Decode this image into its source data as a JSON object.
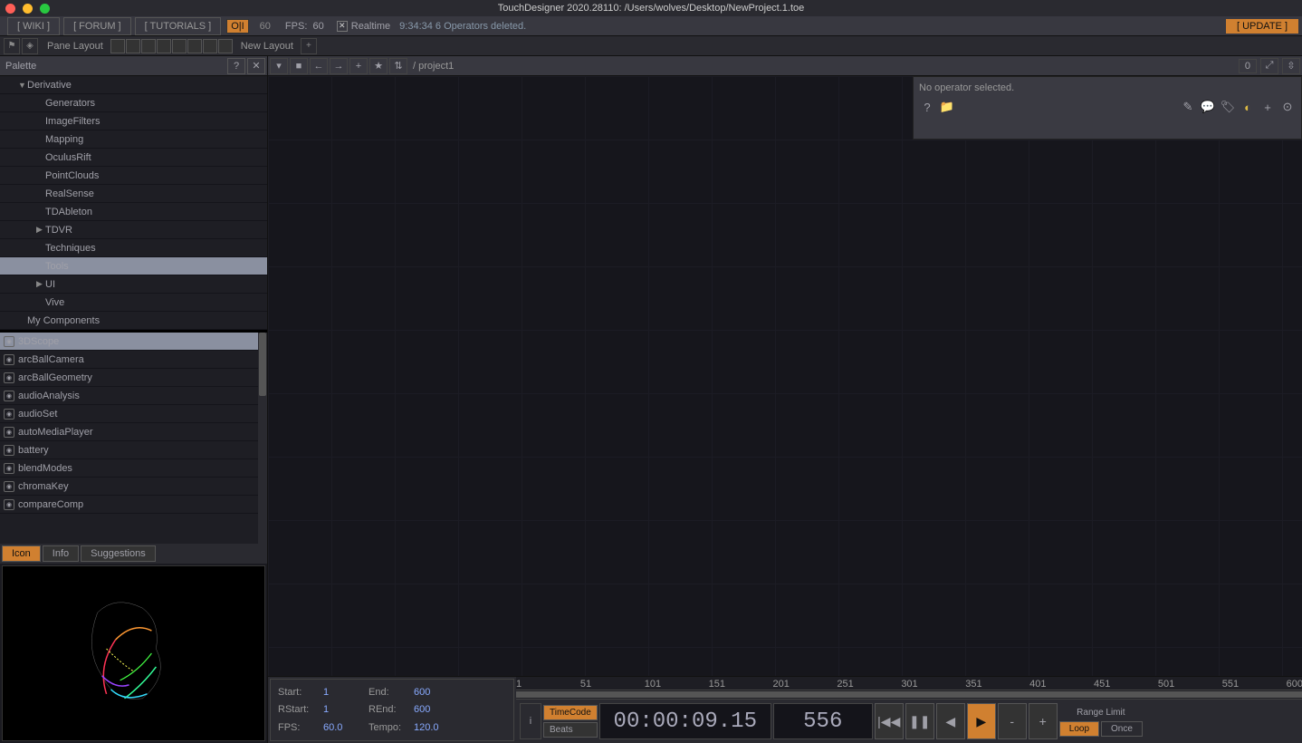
{
  "window_title": "TouchDesigner 2020.28110: /Users/wolves/Desktop/NewProject.1.toe",
  "topbar": {
    "wiki": "[  WIKI  ]",
    "forum": "[  FORUM  ]",
    "tutorials": "[  TUTORIALS  ]",
    "oii": "O|I",
    "sixty": "60",
    "fps_label": "FPS:",
    "fps_value": "60",
    "realtime": "Realtime",
    "status": "9:34:34 6 Operators deleted.",
    "update": "[  UPDATE  ]"
  },
  "panerow": {
    "pane_layout": "Pane Layout",
    "new_layout": "New Layout"
  },
  "palette": {
    "title": "Palette",
    "tree": [
      {
        "label": "Derivative",
        "level": 0,
        "arrow": "▼"
      },
      {
        "label": "Generators",
        "level": 1
      },
      {
        "label": "ImageFilters",
        "level": 1
      },
      {
        "label": "Mapping",
        "level": 1
      },
      {
        "label": "OculusRift",
        "level": 1
      },
      {
        "label": "PointClouds",
        "level": 1
      },
      {
        "label": "RealSense",
        "level": 1
      },
      {
        "label": "TDAbleton",
        "level": 1
      },
      {
        "label": "TDVR",
        "level": 1,
        "arrow": "▶"
      },
      {
        "label": "Techniques",
        "level": 1
      },
      {
        "label": "Tools",
        "level": 1,
        "selected": true
      },
      {
        "label": "UI",
        "level": 1,
        "arrow": "▶"
      },
      {
        "label": "Vive",
        "level": 1
      },
      {
        "label": "My Components",
        "level": 0
      }
    ],
    "components": [
      {
        "label": "3DScope",
        "selected": true
      },
      {
        "label": "arcBallCamera"
      },
      {
        "label": "arcBallGeometry"
      },
      {
        "label": "audioAnalysis"
      },
      {
        "label": "audioSet"
      },
      {
        "label": "autoMediaPlayer"
      },
      {
        "label": "battery"
      },
      {
        "label": "blendModes"
      },
      {
        "label": "chromaKey"
      },
      {
        "label": "compareComp"
      }
    ],
    "tabs": {
      "icon": "Icon",
      "info": "Info",
      "suggestions": "Suggestions"
    }
  },
  "network": {
    "path": "/ project1",
    "count": "0",
    "param_msg": "No operator selected."
  },
  "timeline": {
    "start_lbl": "Start:",
    "start_val": "1",
    "end_lbl": "End:",
    "end_val": "600",
    "rstart_lbl": "RStart:",
    "rstart_val": "1",
    "rend_lbl": "REnd:",
    "rend_val": "600",
    "fps_lbl": "FPS:",
    "fps_val": "60.0",
    "tempo_lbl": "Tempo:",
    "tempo_val": "120.0",
    "ruler": [
      "1",
      "51",
      "101",
      "151",
      "201",
      "251",
      "301",
      "351",
      "401",
      "451",
      "501",
      "551",
      "600"
    ],
    "timecode_btn": "TimeCode",
    "beats_btn": "Beats",
    "timecode": "00:00:09.15",
    "frame": "556",
    "range_limit": "Range Limit",
    "loop": "Loop",
    "once": "Once",
    "i": "i",
    "minus": "-",
    "plus": "+"
  }
}
